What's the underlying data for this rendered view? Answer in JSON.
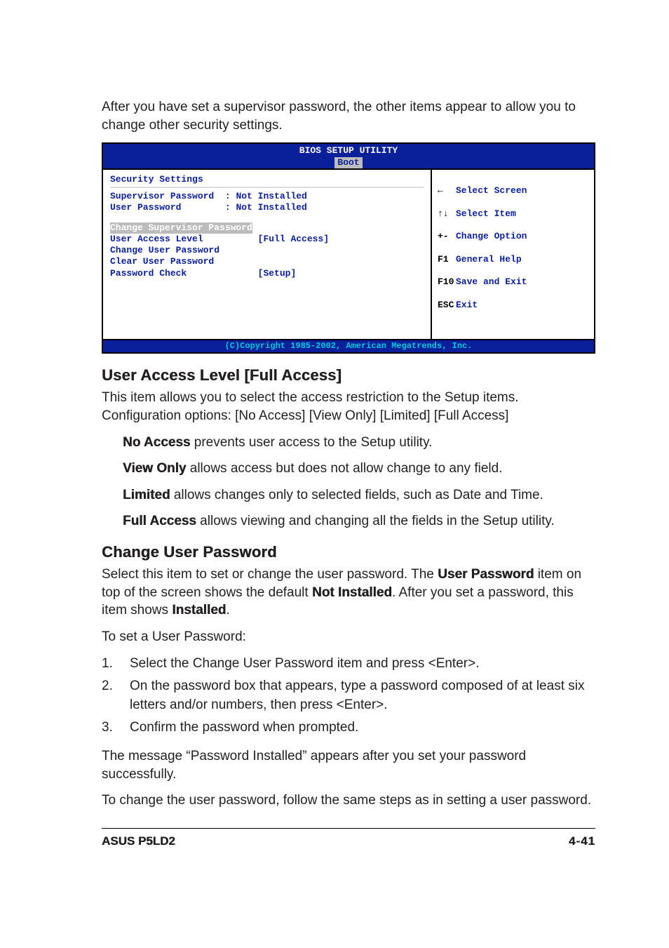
{
  "intro": "After you have set a supervisor password, the other items appear to allow you to change other security settings.",
  "bios": {
    "title": "BIOS SETUP UTILITY",
    "tab": "Boot",
    "section": "Security Settings",
    "sup_label": "Supervisor Password",
    "sup_value": ": Not Installed",
    "usr_label": "User Password",
    "usr_value": ": Not Installed",
    "change_sup": "Change Supervisor Password",
    "ual_label": "User Access Level",
    "ual_value": "[Full Access]",
    "change_usr": "Change User Password",
    "clear_usr": "Clear User Password",
    "pwchk_label": "Password Check",
    "pwchk_value": "[Setup]",
    "help": {
      "k1": "←",
      "v1": "Select Screen",
      "k2": "↑↓",
      "v2": "Select Item",
      "k3": "+-",
      "v3": "Change Option",
      "k4": "F1",
      "v4": "General Help",
      "k5": "F10",
      "v5": "Save and Exit",
      "k6": "ESC",
      "v6": "Exit"
    },
    "footer": "(C)Copyright 1985-2002, American Megatrends, Inc."
  },
  "ual": {
    "heading": "User Access Level [Full Access]",
    "desc": "This item allows you to select the access restriction to the Setup items. Configuration options: [No Access] [View Only] [Limited] [Full Access]",
    "no_b": "No Access",
    "no_t": " prevents user access to the Setup utility.",
    "vo_b": "View Only",
    "vo_t": " allows access but does not allow change to any field.",
    "li_b": "Limited",
    "li_t": " allows changes only to selected fields, such as Date and Time.",
    "fa_b": "Full Access",
    "fa_t": " allows viewing and changing all the fields in the Setup utility."
  },
  "cup": {
    "heading": "Change User Password",
    "p1a": "Select this item to set or change the user password. The ",
    "p1b": "User Password",
    "p1c": " item on top of the screen shows the default ",
    "p1d": "Not Installed",
    "p1e": ". After you set a password, this item shows ",
    "p1f": "Installed",
    "p1g": ".",
    "p2": "To set a User Password:",
    "steps": {
      "s1": "Select the Change User Password item and press <Enter>.",
      "s2": "On the password box that appears, type a password composed of at least six letters and/or numbers, then press <Enter>.",
      "s3": "Confirm the password when prompted."
    },
    "p3": "The message “Password Installed” appears after you set your password successfully.",
    "p4": "To change the user password, follow the same steps as in setting a user password."
  },
  "footer": {
    "product": "ASUS P5LD2",
    "page": "4-41"
  }
}
